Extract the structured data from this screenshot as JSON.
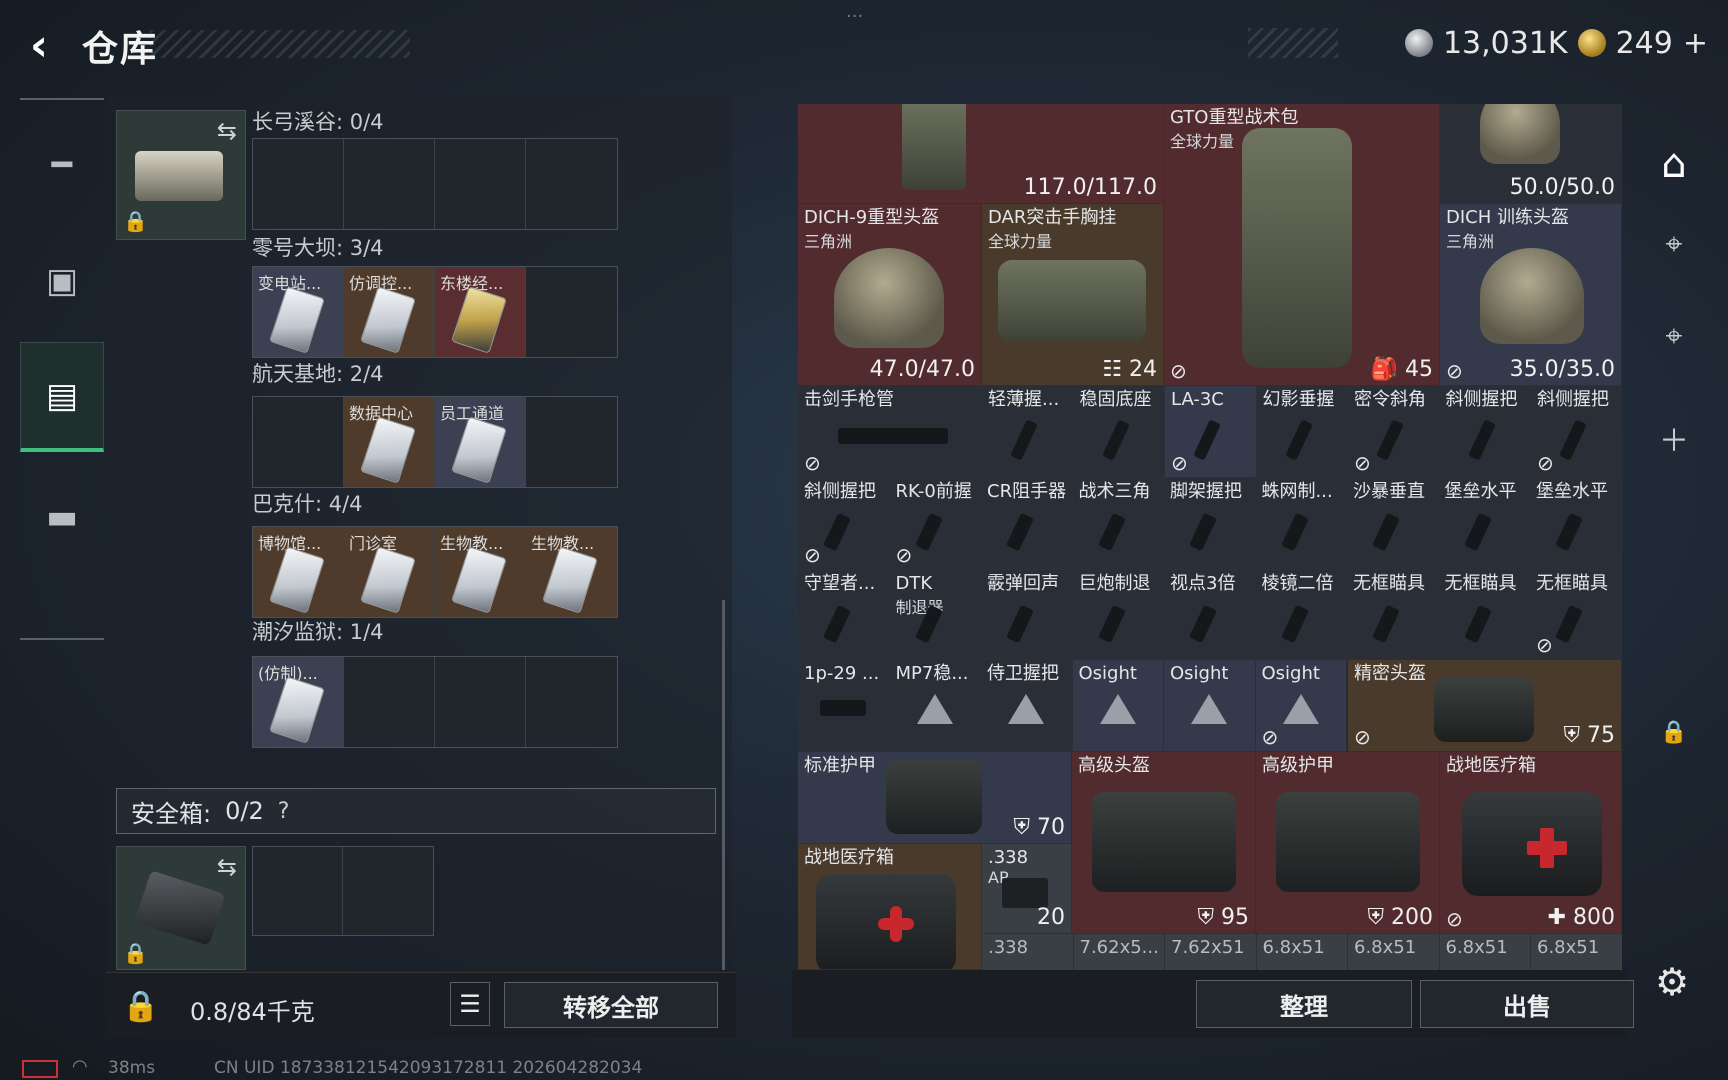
{
  "header": {
    "title": "仓库",
    "back_icon": "back-arrow-icon",
    "dots": "···"
  },
  "currency": {
    "silver": "13,031K",
    "gold": "249",
    "add": "+"
  },
  "leftnav": {
    "items": [
      "gun-icon",
      "vest-icon",
      "backpack-icon",
      "briefcase-icon"
    ],
    "active_index": 2
  },
  "keychain": {
    "sections": [
      {
        "label": "长弓溪谷: 0/4",
        "cells": [
          {
            "name": "",
            "color": "empty"
          },
          {
            "name": "",
            "color": "empty"
          },
          {
            "name": "",
            "color": "empty"
          },
          {
            "name": "",
            "color": "empty"
          }
        ]
      },
      {
        "label": "零号大坝: 3/4",
        "cells": [
          {
            "name": "变电站...",
            "color": "slate"
          },
          {
            "name": "仿调控...",
            "color": "brown"
          },
          {
            "name": "东楼经...",
            "color": "red"
          },
          {
            "name": "",
            "color": "empty"
          }
        ]
      },
      {
        "label": "航天基地: 2/4",
        "cells": [
          {
            "name": "",
            "color": "empty"
          },
          {
            "name": "数据中心",
            "color": "brown"
          },
          {
            "name": "员工通道",
            "color": "slate"
          },
          {
            "name": "",
            "color": "empty"
          }
        ]
      },
      {
        "label": "巴克什: 4/4",
        "cells": [
          {
            "name": "博物馆...",
            "color": "brown"
          },
          {
            "name": "门诊室",
            "color": "brown"
          },
          {
            "name": "生物教...",
            "color": "brown"
          },
          {
            "name": "生物教...",
            "color": "brown"
          }
        ]
      },
      {
        "label": "潮汐监狱: 1/4",
        "cells": [
          {
            "name": "(仿制)...",
            "color": "slate"
          },
          {
            "name": "",
            "color": "empty"
          },
          {
            "name": "",
            "color": "empty"
          },
          {
            "name": "",
            "color": "empty"
          }
        ]
      }
    ]
  },
  "safebox": {
    "label": "安全箱:",
    "value": "0/2",
    "help": "?"
  },
  "weight": {
    "current": "0.8",
    "max": "/84千克"
  },
  "buttons": {
    "transfer_all": "转移全部",
    "sort": "整理",
    "sell": "出售"
  },
  "grid_items": {
    "top_left_val": "117.0/117.0",
    "top_right_val": "50.0/50.0",
    "gto_name": "GTO重型战术包",
    "gto_sub": "全球力量",
    "gto_val": "45",
    "dich9_name": "DICH-9重型头盔",
    "dich9_sub": "三角洲",
    "dich9_val": "47.0/47.0",
    "dar_name": "DAR突击手胸挂",
    "dar_sub": "全球力量",
    "dar_val": "24",
    "dichtr_name": "DICH 训练头盔",
    "dichtr_sub": "三角洲",
    "dichtr_val": "35.0/35.0",
    "row3": [
      "击剑手枪管",
      "轻薄握...",
      "稳固底座",
      "LA-3C",
      "幻影垂握",
      "密令斜角",
      "斜侧握把",
      "斜侧握把"
    ],
    "row4": [
      "斜侧握把",
      "RK-0前握",
      "CR阻手器",
      "战术三角",
      "脚架握把",
      "蛛网制...",
      "沙暴垂直",
      "堡垒水平",
      "堡垒水平"
    ],
    "row5": [
      "守望者...",
      "DTK",
      "霰弹回声",
      "巨炮制退",
      "视点3倍",
      "棱镜二倍",
      "无框瞄具",
      "无框瞄具",
      "无框瞄具"
    ],
    "row5_dtk_sub": "制退器",
    "row6": [
      "1p-29 ...",
      "MP7稳...",
      "侍卫握把",
      "Osight",
      "Osight",
      "Osight"
    ],
    "precise_helmet": "精密头盔",
    "precise_val": "75",
    "std_armor": "标准护甲",
    "std_armor_val": "70",
    "adv_helmet": "高级头盔",
    "adv_helmet_val": "95",
    "adv_armor": "高级护甲",
    "adv_armor_val": "200",
    "medkit1": "战地医疗箱",
    "medkit1_val": "800",
    "medkit2": "战地医疗箱",
    "ammo338": ".338",
    "ammo338_sub": "AP",
    "ammo338_count": "20",
    "bottom_row": [
      ".338",
      "7.62x5...",
      "7.62x51",
      "6.8x51",
      "6.8x51",
      "6.8x51",
      "6.8x51"
    ]
  },
  "rightnav": {
    "icons": [
      "home-icon",
      "scope-iv-icon",
      "scope-iv-icon",
      "plus-icon",
      "lock-icon",
      "gear-icon"
    ]
  },
  "footer": {
    "ping": "38ms",
    "uid": "CN UID 187338121542093172811 202604282034"
  }
}
